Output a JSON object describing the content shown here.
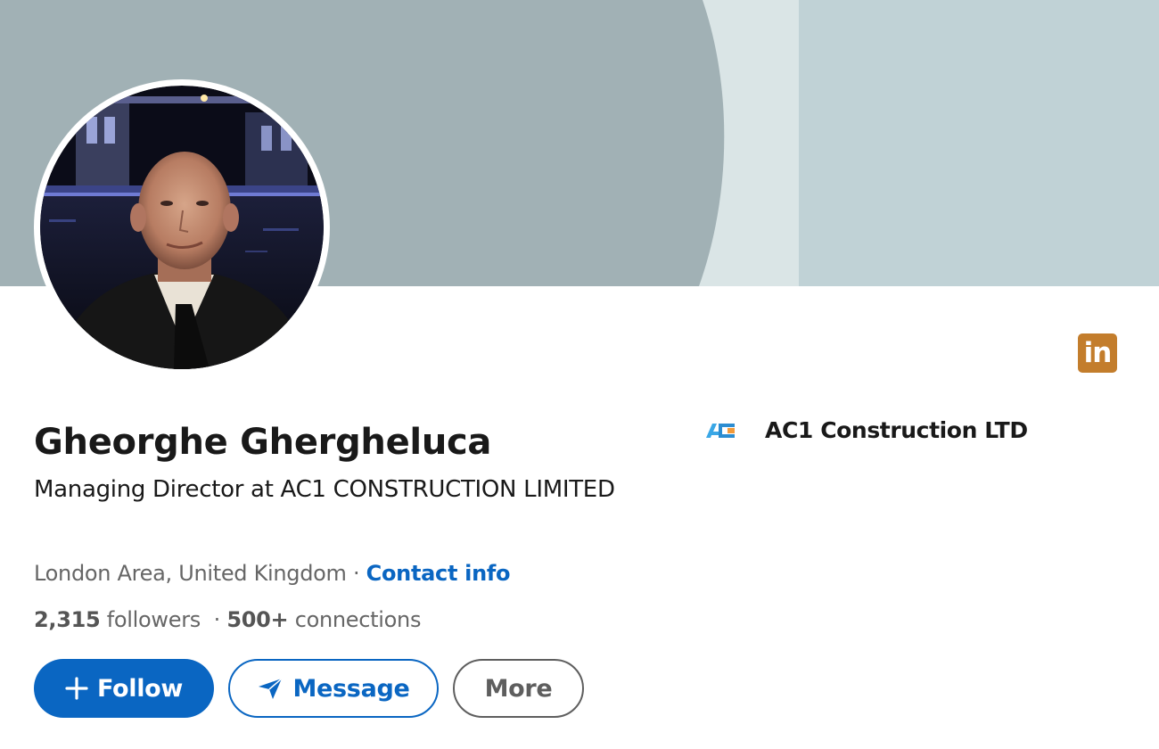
{
  "profile": {
    "name": "Gheorghe Ghergheluca",
    "headline": "Managing Director at AC1 CONSTRUCTION LIMITED",
    "location": "London Area, United Kingdom",
    "separator": "·",
    "contact_info_label": "Contact info",
    "followers_count": "2,315",
    "followers_label": "followers",
    "connections_count": "500+",
    "connections_label": "connections"
  },
  "actions": {
    "follow_label": "Follow",
    "message_label": "Message",
    "more_label": "More"
  },
  "company": {
    "name": "AC1 Construction LTD",
    "logo_text": "AC1"
  },
  "badge": {
    "text": "in",
    "icon": "linkedin-icon"
  },
  "colors": {
    "primary_blue": "#0a66c2",
    "badge_orange": "#c37d2c",
    "banner_dark": "#a1b1b5",
    "banner_light": "#c0d2d6",
    "banner_pale": "#dae5e6",
    "text_primary": "#191919",
    "text_secondary": "#666666"
  }
}
